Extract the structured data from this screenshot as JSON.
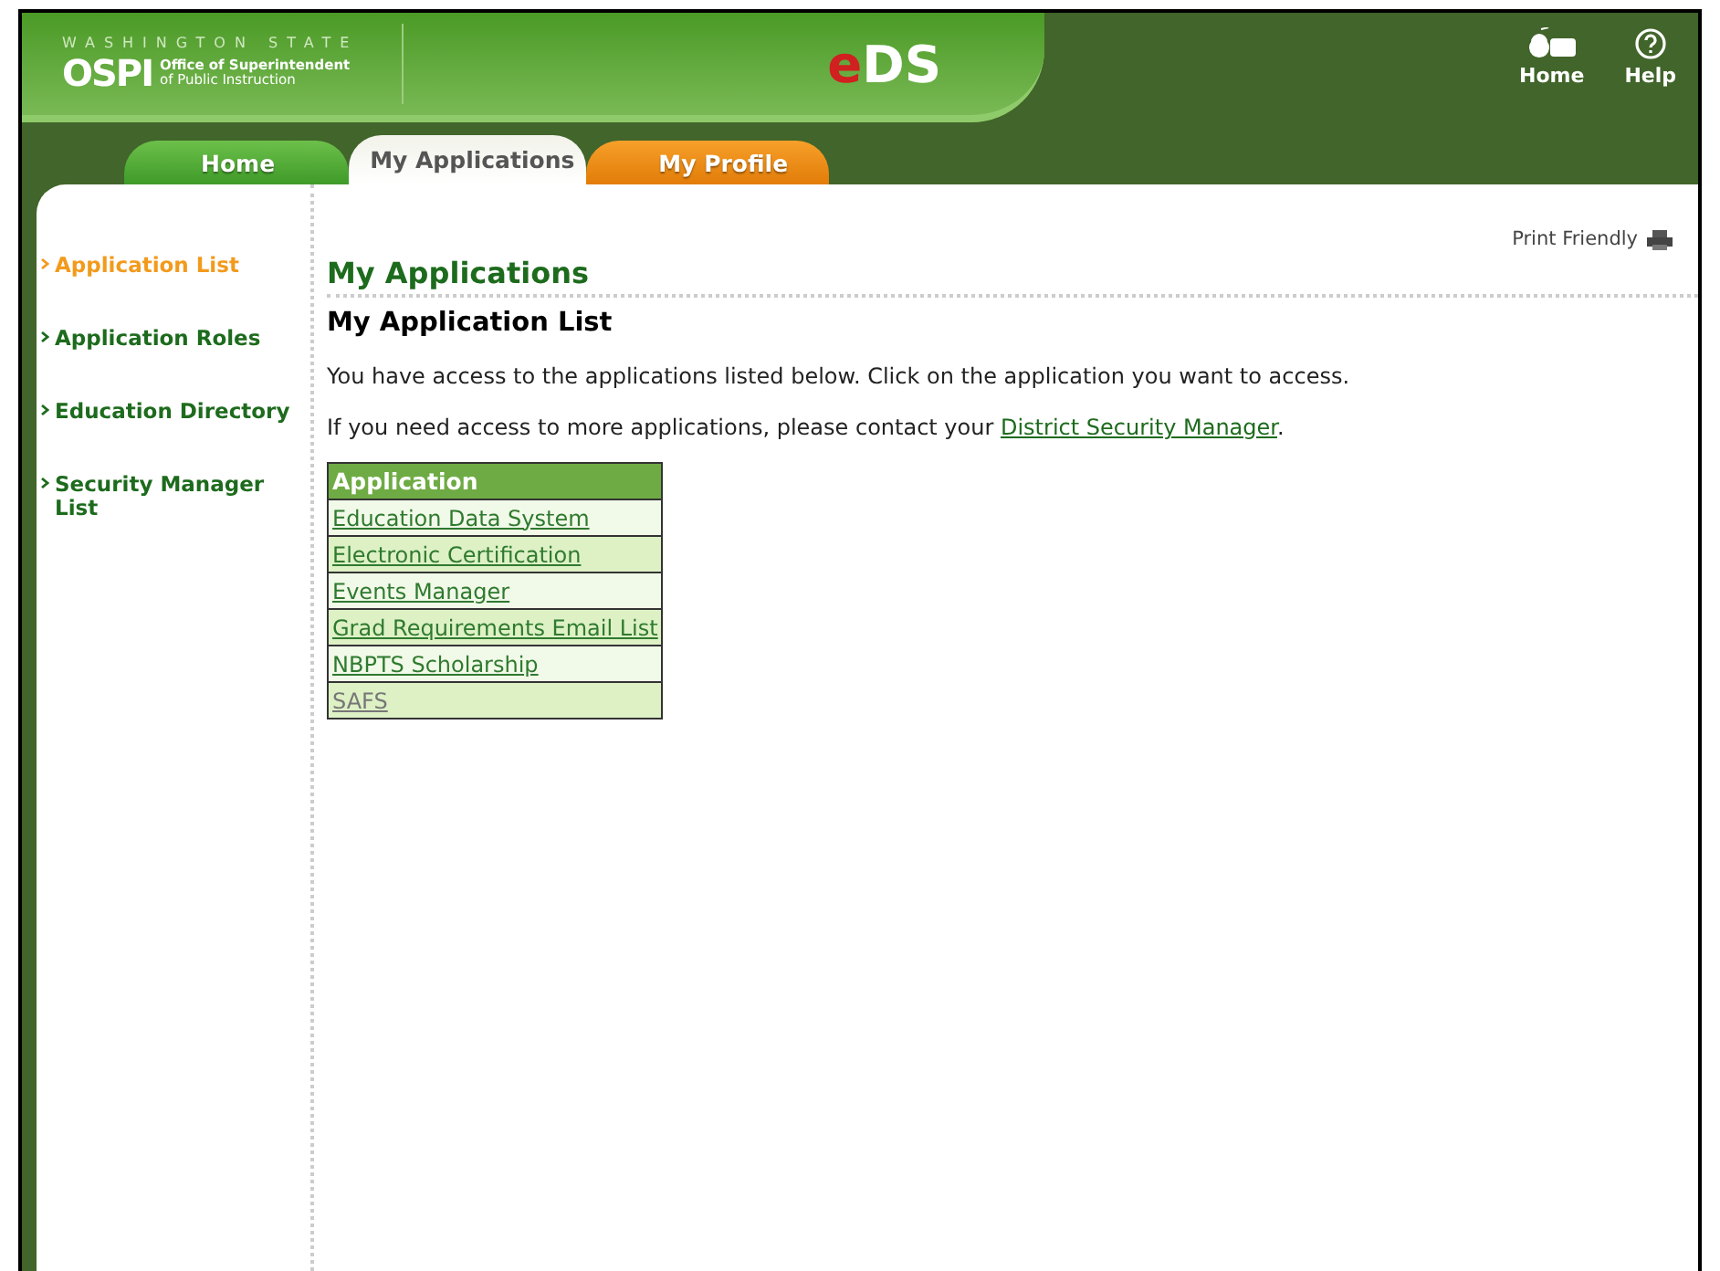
{
  "header": {
    "state_label": "WASHINGTON STATE",
    "agency_short": "OSPI",
    "agency_line_1": "Office of Superintendent",
    "agency_line_2": "of Public Instruction",
    "app_logo_e": "e",
    "app_logo_rest": "DS",
    "links": [
      {
        "kind": "home",
        "label": "Home"
      },
      {
        "kind": "help",
        "label": "Help"
      }
    ]
  },
  "tabs": [
    {
      "label": "Home",
      "kind": "green",
      "selected": false
    },
    {
      "label": "My Applications",
      "kind": "grey",
      "selected": true
    },
    {
      "label": "My Profile",
      "kind": "orange",
      "selected": false
    }
  ],
  "sidebar": {
    "items": [
      {
        "label": "Application List",
        "selected": true
      },
      {
        "label": "Application Roles",
        "selected": false
      },
      {
        "label": "Education Directory",
        "selected": false
      },
      {
        "label": "Security Manager List",
        "selected": false
      }
    ]
  },
  "print_link": "Print Friendly",
  "page_title": "My Applications",
  "section_title": "My Application List",
  "intro": "You have access to the applications listed below. Click on the application you want to access.",
  "contact": {
    "before": "If you need access to more applications, please contact your ",
    "link": "District Security Manager",
    "after": "."
  },
  "table": {
    "columns": [
      "Application"
    ],
    "rows": [
      {
        "name": "Education Data System",
        "visited": false
      },
      {
        "name": "Electronic Certification",
        "visited": false
      },
      {
        "name": "Events Manager",
        "visited": false
      },
      {
        "name": "Grad Requirements Email List",
        "visited": false
      },
      {
        "name": "NBPTS Scholarship",
        "visited": false
      },
      {
        "name": "SAFS",
        "visited": true
      }
    ]
  }
}
